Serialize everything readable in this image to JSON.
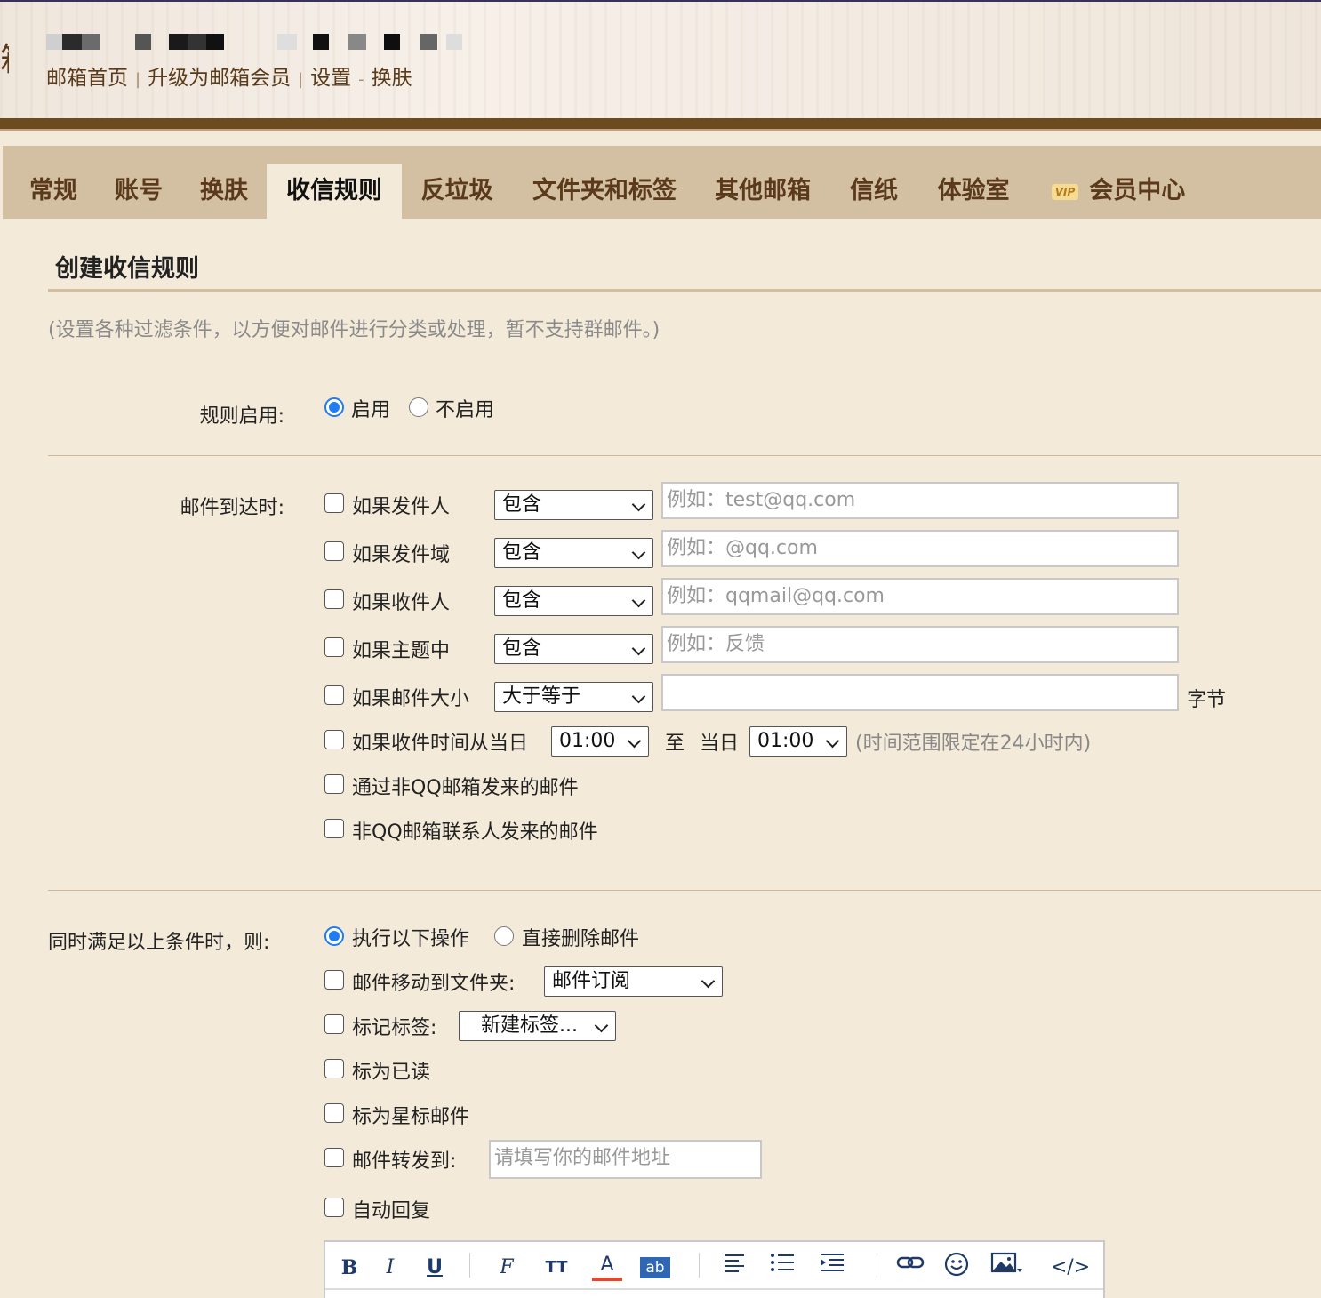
{
  "header": {
    "logo_fragment": "箱",
    "links": [
      "邮箱首页",
      "升级为邮箱会员",
      "设置",
      "换肤"
    ]
  },
  "tabs": [
    {
      "label": "常规"
    },
    {
      "label": "账号"
    },
    {
      "label": "换肤"
    },
    {
      "label": "收信规则",
      "active": true
    },
    {
      "label": "反垃圾"
    },
    {
      "label": "文件夹和标签"
    },
    {
      "label": "其他邮箱"
    },
    {
      "label": "信纸"
    },
    {
      "label": "体验室"
    },
    {
      "label": "会员中心",
      "badge": "VIP"
    }
  ],
  "page": {
    "title": "创建收信规则",
    "description": "(设置各种过滤条件，以方便对邮件进行分类或处理，暂不支持群邮件。)"
  },
  "rule_enable": {
    "label": "规则启用:",
    "options": [
      "启用",
      "不启用"
    ],
    "selected": "启用"
  },
  "conditions": {
    "label": "邮件到达时:",
    "rows": [
      {
        "label": "如果发件人",
        "select": "包含",
        "placeholder": "例如：test@qq.com"
      },
      {
        "label": "如果发件域",
        "select": "包含",
        "placeholder": "例如：@qq.com"
      },
      {
        "label": "如果收件人",
        "select": "包含",
        "placeholder": "例如：qqmail@qq.com"
      },
      {
        "label": "如果主题中",
        "select": "包含",
        "placeholder": "例如：反馈"
      },
      {
        "label": "如果邮件大小",
        "select": "大于等于",
        "placeholder": "",
        "unit": "字节"
      }
    ],
    "time_row": {
      "label": "如果收件时间从当日",
      "from": "01:00",
      "to_label": "至",
      "day_label": "当日",
      "to": "01:00",
      "hint": "(时间范围限定在24小时内)"
    },
    "extra": [
      "通过非QQ邮箱发来的邮件",
      "非QQ邮箱联系人发来的邮件"
    ]
  },
  "actions": {
    "label": "同时满足以上条件时，则:",
    "mode_options": [
      "执行以下操作",
      "直接删除邮件"
    ],
    "mode_selected": "执行以下操作",
    "move_label": "邮件移动到文件夹:",
    "move_folder": "邮件订阅",
    "tag_label": "标记标签:",
    "tag_value": "新建标签...",
    "mark_read": "标为已读",
    "mark_star": "标为星标邮件",
    "forward_label": "邮件转发到:",
    "forward_placeholder": "请填写你的邮件地址",
    "auto_reply": "自动回复"
  },
  "editor_toolbar": {
    "bold": "B",
    "italic": "I",
    "underline": "U",
    "font_glyph": "F",
    "size_glyph": "TT",
    "color_glyph": "A",
    "bg_glyph": "ab",
    "code_glyph": "</>"
  },
  "colors": {
    "tab_bar": "#d3bfa2",
    "page_bg": "#f4ead9",
    "brown_bar": "#6e4a1f",
    "accent_blue": "#1f7cf1"
  }
}
